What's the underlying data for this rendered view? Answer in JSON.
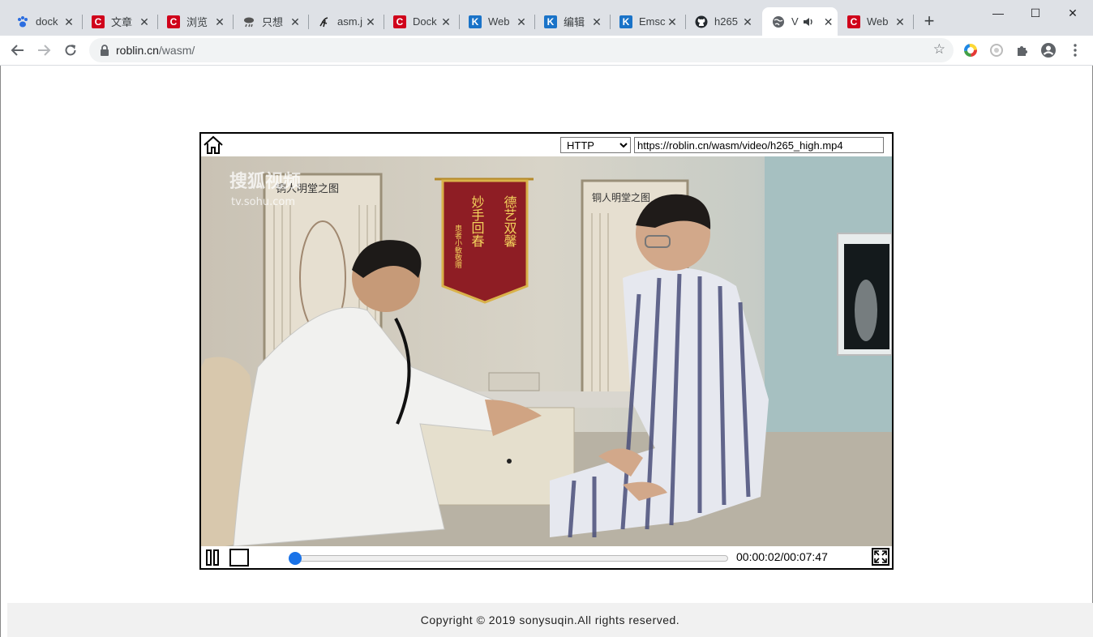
{
  "browser": {
    "tabs": [
      {
        "icon": "paw-icon",
        "title": "dock"
      },
      {
        "icon": "csdn-icon",
        "title": "文章"
      },
      {
        "icon": "csdn-icon",
        "title": "浏览"
      },
      {
        "icon": "cloud-rain-icon",
        "title": "只想"
      },
      {
        "icon": "script-icon",
        "title": "asm.j"
      },
      {
        "icon": "csdn-icon",
        "title": "Dock"
      },
      {
        "icon": "k-icon",
        "title": "Web"
      },
      {
        "icon": "k-icon",
        "title": "编辑"
      },
      {
        "icon": "k-icon",
        "title": "Emsc"
      },
      {
        "icon": "github-icon",
        "title": "h265"
      },
      {
        "icon": "globe-icon",
        "title": "V",
        "active": true,
        "audio": true
      },
      {
        "icon": "csdn-icon",
        "title": "Web"
      }
    ],
    "tab_close_glyph": "✕",
    "new_tab_glyph": "+",
    "window_buttons": {
      "minimize": "—",
      "maximize": "☐",
      "close": "✕"
    },
    "address": {
      "domain": "roblin.cn",
      "path": "/wasm/"
    }
  },
  "player": {
    "protocol_selected": "HTTP",
    "protocol_options": [
      "HTTP"
    ],
    "video_url": "https://roblin.cn/wasm/video/h265_high.mp4",
    "progress_fraction": 0.005,
    "time_display": "00:00:02/00:07:47"
  },
  "video_frame": {
    "watermark_main": "搜狐视频",
    "watermark_sub": "tv.sohu.com",
    "poster_left_title": "铜人明堂之图",
    "poster_right_title": "铜人明堂之图",
    "pennant_line1": "德艺双馨",
    "pennant_line2": "妙手回春",
    "pennant_sign": "患者小敏敬赠"
  },
  "footer": {
    "copyright": "Copyright © 2019 sonysuqin.All rights reserved."
  },
  "colors": {
    "accent": "#1a73e8",
    "tabstrip": "#dee1e6",
    "omnibox": "#f1f3f4",
    "footer_bg": "#f1f1f1"
  }
}
